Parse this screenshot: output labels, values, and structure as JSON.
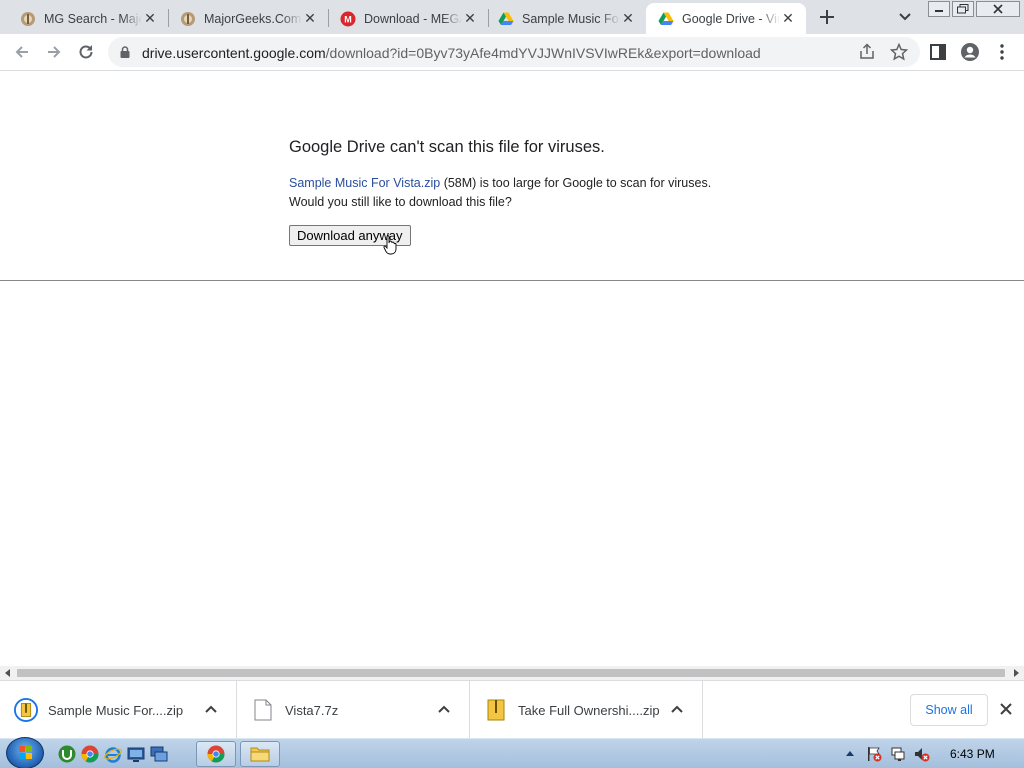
{
  "tabs": [
    {
      "title": "MG Search - MajorGeeks",
      "icon": "majorgeeks-icon",
      "active": false
    },
    {
      "title": "MajorGeeks.Com",
      "icon": "majorgeeks-icon",
      "active": false
    },
    {
      "title": "Download - MEGA",
      "icon": "mega-icon",
      "active": false
    },
    {
      "title": "Sample Music For Vista",
      "icon": "google-drive-icon",
      "active": false
    },
    {
      "title": "Google Drive - Virus scan warning",
      "icon": "google-drive-icon",
      "active": true
    }
  ],
  "toolbar": {
    "url_host": "drive.usercontent.google.com",
    "url_path": "/download?id=0Byv73yAfe4mdYVJJWnIVSVIwREk&export=download"
  },
  "page": {
    "heading": "Google Drive can't scan this file for viruses.",
    "file_link": "Sample Music For Vista.zip",
    "size_text": " (58M) is too large for Google to scan for viruses.",
    "question": "Would you still like to download this file?",
    "download_button": "Download anyway"
  },
  "downloads": {
    "items": [
      {
        "name": "Sample Music For....zip",
        "icon": "zip-file-icon"
      },
      {
        "name": "Vista7.7z",
        "icon": "file-icon"
      },
      {
        "name": "Take Full Ownershi....zip",
        "icon": "zip-file-icon"
      }
    ],
    "show_all": "Show all"
  },
  "taskbar": {
    "clock": "6:43 PM"
  },
  "colors": {
    "tabstrip": "#dee1e6",
    "link": "#2a4e9e",
    "accent": "#1a73e8"
  }
}
